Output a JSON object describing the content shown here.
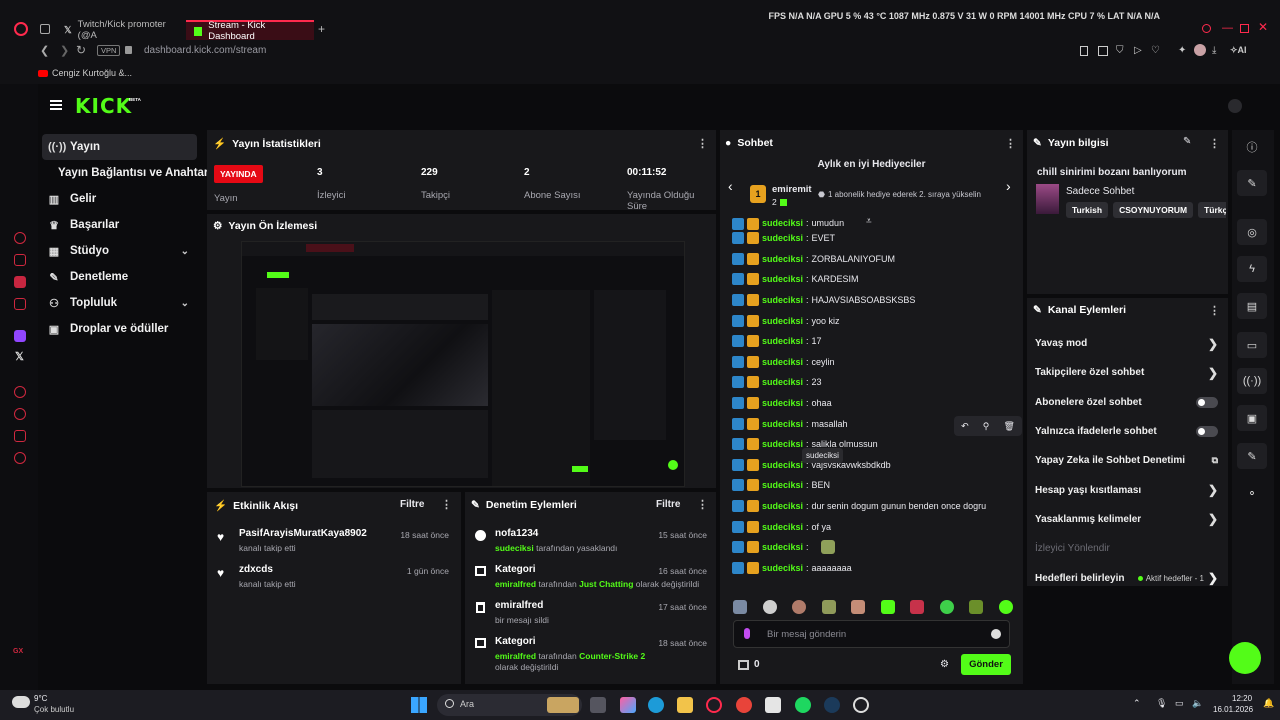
{
  "browser": {
    "tabs": [
      {
        "label": "Twitch/Kick promoter (@A"
      },
      {
        "label": "Stream - Kick Dashboard"
      }
    ],
    "url": "dashboard.kick.com/stream",
    "vpn_label": "VPN",
    "bookmark": "Cengiz Kurtoğlu &...",
    "hud": "FPS  N/A  N/A     GPU  5 %  43 °C  1087 MHz  0.875 V  31 W  0 RPM  14001 MHz     CPU  7 %     LAT  N/A  N/A",
    "ai_label": "AI"
  },
  "kick": {
    "logo": "KICK",
    "logo_beta": "BETA",
    "nav": [
      {
        "label": "Yayın",
        "icon": "broadcast-icon"
      },
      {
        "label": "Yayın Bağlantısı ve Anahtarı",
        "icon": ""
      },
      {
        "label": "Gelir",
        "icon": "chart-icon"
      },
      {
        "label": "Başarılar",
        "icon": "trophy-icon"
      },
      {
        "label": "Stüdyo",
        "icon": "grid-icon"
      },
      {
        "label": "Denetleme",
        "icon": "wrench-icon"
      },
      {
        "label": "Topluluk",
        "icon": "users-icon"
      },
      {
        "label": "Droplar ve ödüller",
        "icon": "gift-icon"
      }
    ]
  },
  "stats": {
    "title": "Yayın İstatistikleri",
    "live_badge": "YAYINDA",
    "live_label": "Yayın",
    "items": [
      {
        "value": "3",
        "label": "İzleyici"
      },
      {
        "value": "229",
        "label": "Takipçi"
      },
      {
        "value": "2",
        "label": "Abone Sayısı"
      },
      {
        "value": "00:11:52",
        "label": "Yayında Olduğu Süre"
      }
    ]
  },
  "preview": {
    "title": "Yayın Ön İzlemesi"
  },
  "activity": {
    "title": "Etkinlik Akışı",
    "filter": "Filtre",
    "items": [
      {
        "name": "PasifArayisMuratKaya8902",
        "sub": "kanalı takip etti",
        "time": "18 saat önce"
      },
      {
        "name": "zdxcds",
        "sub": "kanalı takip etti",
        "time": "1 gün önce"
      }
    ]
  },
  "moderation": {
    "title": "Denetim Eylemleri",
    "filter": "Filtre",
    "items": [
      {
        "name": "nofa1234",
        "actor": "sudeciksi",
        "rest": " tarafından yasaklandı",
        "time": "15 saat önce"
      },
      {
        "name": "Kategori",
        "actor": "emiralfred",
        "mid": " tarafından ",
        "category": "Just Chatting",
        "rest": " olarak değiştirildi",
        "time": "16 saat önce"
      },
      {
        "name": "emiralfred",
        "actor": "",
        "rest": "bir mesajı sildi",
        "time": "17 saat önce"
      },
      {
        "name": "Kategori",
        "actor": "emiralfred",
        "mid": " tarafından ",
        "category": "Counter-Strike 2",
        "rest": " olarak değiştirildi",
        "time": "18 saat önce"
      }
    ]
  },
  "chat": {
    "title": "Sohbet",
    "gifters_title": "Aylık en iyi Hediyeciler",
    "top_gifter": {
      "rank": "1",
      "name": "emiremit",
      "count": "2"
    },
    "gifter_hint": "1 abonelik hediye ederek 2. sıraya yükselin",
    "partial_top": "umudun",
    "username": "sudeciksi",
    "messages": [
      "EVET",
      "ZORBALANIYOFUM",
      "KARDESIM",
      "HAJAVSIABSOABSKSBS",
      "yoo kiz",
      "17",
      "ceylin",
      "23",
      "ohaa",
      "masallah",
      "salikla olmussun",
      "vajsvskavwksbdkdb",
      "BEN",
      "dur senin dogum gunun benden once dogru",
      "of ya",
      "",
      "aaaaaaaa"
    ],
    "tooltip": "sudeciksi",
    "input_placeholder": "Bir mesaj gönderin",
    "points": "0",
    "send": "Gönder"
  },
  "stream_info": {
    "title": "Yayın bilgisi",
    "stream_title": "chill sinirimi bozanı banlıyorum",
    "category": "Sadece Sohbet",
    "tags": [
      "Turkish",
      "CSOYNUYORUM",
      "Türkç"
    ]
  },
  "channel_actions": {
    "title": "Kanal Eylemleri",
    "rows": [
      {
        "label": "Yavaş mod",
        "kind": "chevron"
      },
      {
        "label": "Takipçilere özel sohbet",
        "kind": "chevron"
      },
      {
        "label": "Abonelere özel sohbet",
        "kind": "toggle"
      },
      {
        "label": "Yalnızca ifadelerle sohbet",
        "kind": "toggle"
      },
      {
        "label": "Yapay Zeka ile Sohbet Denetimi",
        "kind": "external"
      },
      {
        "label": "Hesap yaşı kısıtlaması",
        "kind": "chevron"
      },
      {
        "label": "Yasaklanmış kelimeler",
        "kind": "chevron"
      },
      {
        "label": "İzleyici Yönlendir",
        "kind": "disabled"
      },
      {
        "label": "Hedefleri belirleyin",
        "kind": "goal"
      }
    ],
    "goal_status": "Aktif hedefler - 1"
  },
  "taskbar": {
    "weather_temp": "9°C",
    "weather_desc": "Çok bulutlu",
    "search": "Ara",
    "time": "12:20",
    "date": "16.01.2026"
  },
  "colors": {
    "accent": "#53fc18",
    "live": "#e50914",
    "opera": "#ff2a4d"
  }
}
